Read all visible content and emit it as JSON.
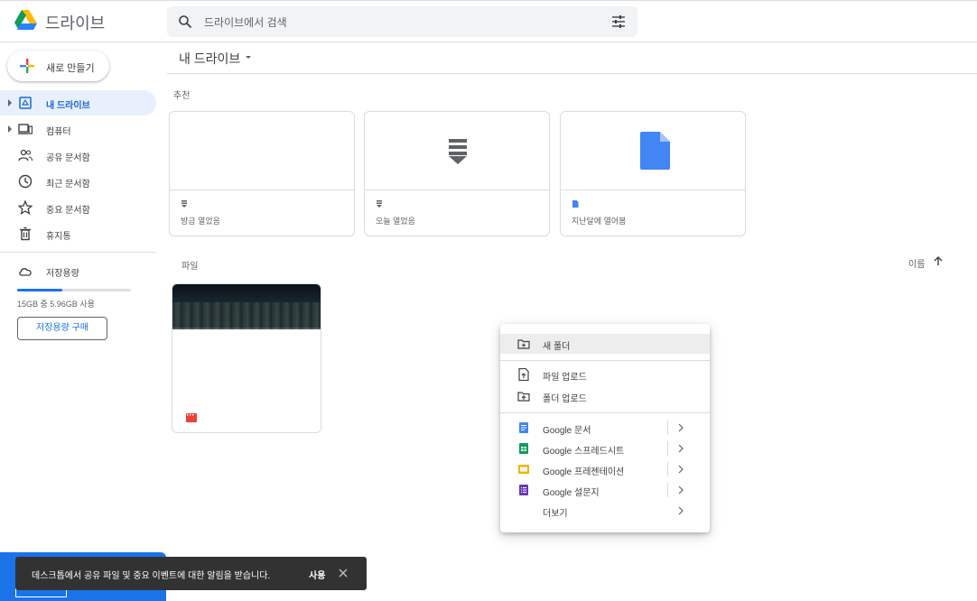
{
  "app": {
    "title": "드라이브"
  },
  "search": {
    "placeholder": "드라이브에서 검색"
  },
  "sidebar": {
    "new_label": "새로 만들기",
    "items": [
      {
        "label": "내 드라이브",
        "icon": "my-drive-icon",
        "active": true,
        "expandable": true
      },
      {
        "label": "컴퓨터",
        "icon": "computer-icon",
        "active": false,
        "expandable": true
      },
      {
        "label": "공유 문서함",
        "icon": "people-icon",
        "active": false,
        "expandable": false
      },
      {
        "label": "최근 문서함",
        "icon": "clock-icon",
        "active": false,
        "expandable": false
      },
      {
        "label": "중요 문서함",
        "icon": "star-icon",
        "active": false,
        "expandable": false
      },
      {
        "label": "휴지통",
        "icon": "trash-icon",
        "active": false,
        "expandable": false
      }
    ],
    "storage_label": "저장용량",
    "storage_text": "15GB 중 5.96GB 사용",
    "storage_used_fraction": 0.397,
    "buy_label": "저장용량 구매"
  },
  "main": {
    "title": "내 드라이브",
    "suggested_label": "추천",
    "suggested": [
      {
        "subtitle": "방금 열었음"
      },
      {
        "subtitle": "오늘 열었음"
      },
      {
        "subtitle": "지난달에 열어봄"
      }
    ],
    "files_label": "파일",
    "sort_label": "이름"
  },
  "context_menu": {
    "items": [
      {
        "label": "새 폴더",
        "icon": "new-folder-icon"
      },
      {
        "label": "파일 업로드",
        "icon": "file-upload-icon"
      },
      {
        "label": "폴더 업로드",
        "icon": "folder-upload-icon"
      },
      {
        "label": "Google 문서",
        "icon": "docs-icon"
      },
      {
        "label": "Google 스프레드시트",
        "icon": "sheets-icon"
      },
      {
        "label": "Google 프레젠테이션",
        "icon": "slides-icon"
      },
      {
        "label": "Google 설문지",
        "icon": "forms-icon"
      },
      {
        "label": "더보기",
        "icon": ""
      }
    ]
  },
  "toast": {
    "message": "데스크톱에서 공유 파일 및 중요 이벤트에 대한 알림을 받습니다.",
    "action": "사용"
  },
  "colors": {
    "accent": "#1a73e8",
    "docs": "#4285f4",
    "sheets": "#0f9d58",
    "slides": "#f4b400",
    "forms": "#673ab7",
    "video": "#ea4335"
  }
}
